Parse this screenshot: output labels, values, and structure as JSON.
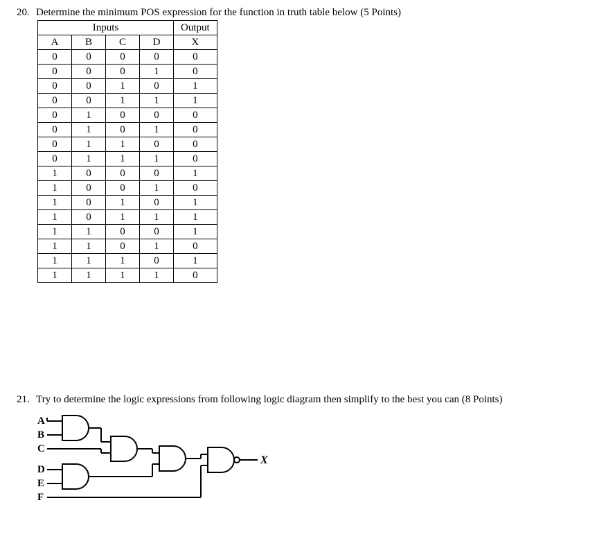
{
  "q20": {
    "number": "20.",
    "text": "Determine the minimum POS expression for the function in truth table below (5 Points)",
    "table": {
      "group_headers": {
        "inputs": "Inputs",
        "output": "Output"
      },
      "headers": [
        "A",
        "B",
        "C",
        "D",
        "X"
      ],
      "rows": [
        [
          "0",
          "0",
          "0",
          "0",
          "0"
        ],
        [
          "0",
          "0",
          "0",
          "1",
          "0"
        ],
        [
          "0",
          "0",
          "1",
          "0",
          "1"
        ],
        [
          "0",
          "0",
          "1",
          "1",
          "1"
        ],
        [
          "0",
          "1",
          "0",
          "0",
          "0"
        ],
        [
          "0",
          "1",
          "0",
          "1",
          "0"
        ],
        [
          "0",
          "1",
          "1",
          "0",
          "0"
        ],
        [
          "0",
          "1",
          "1",
          "1",
          "0"
        ],
        [
          "1",
          "0",
          "0",
          "0",
          "1"
        ],
        [
          "1",
          "0",
          "0",
          "1",
          "0"
        ],
        [
          "1",
          "0",
          "1",
          "0",
          "1"
        ],
        [
          "1",
          "0",
          "1",
          "1",
          "1"
        ],
        [
          "1",
          "1",
          "0",
          "0",
          "1"
        ],
        [
          "1",
          "1",
          "0",
          "1",
          "0"
        ],
        [
          "1",
          "1",
          "1",
          "0",
          "1"
        ],
        [
          "1",
          "1",
          "1",
          "1",
          "0"
        ]
      ]
    }
  },
  "q21": {
    "number": "21.",
    "text": "Try to determine the logic expressions from following logic diagram then simplify to the best you can (8 Points)",
    "labels": {
      "A": "A",
      "B": "B",
      "C": "C",
      "D": "D",
      "E": "E",
      "F": "F",
      "X": "X"
    }
  }
}
